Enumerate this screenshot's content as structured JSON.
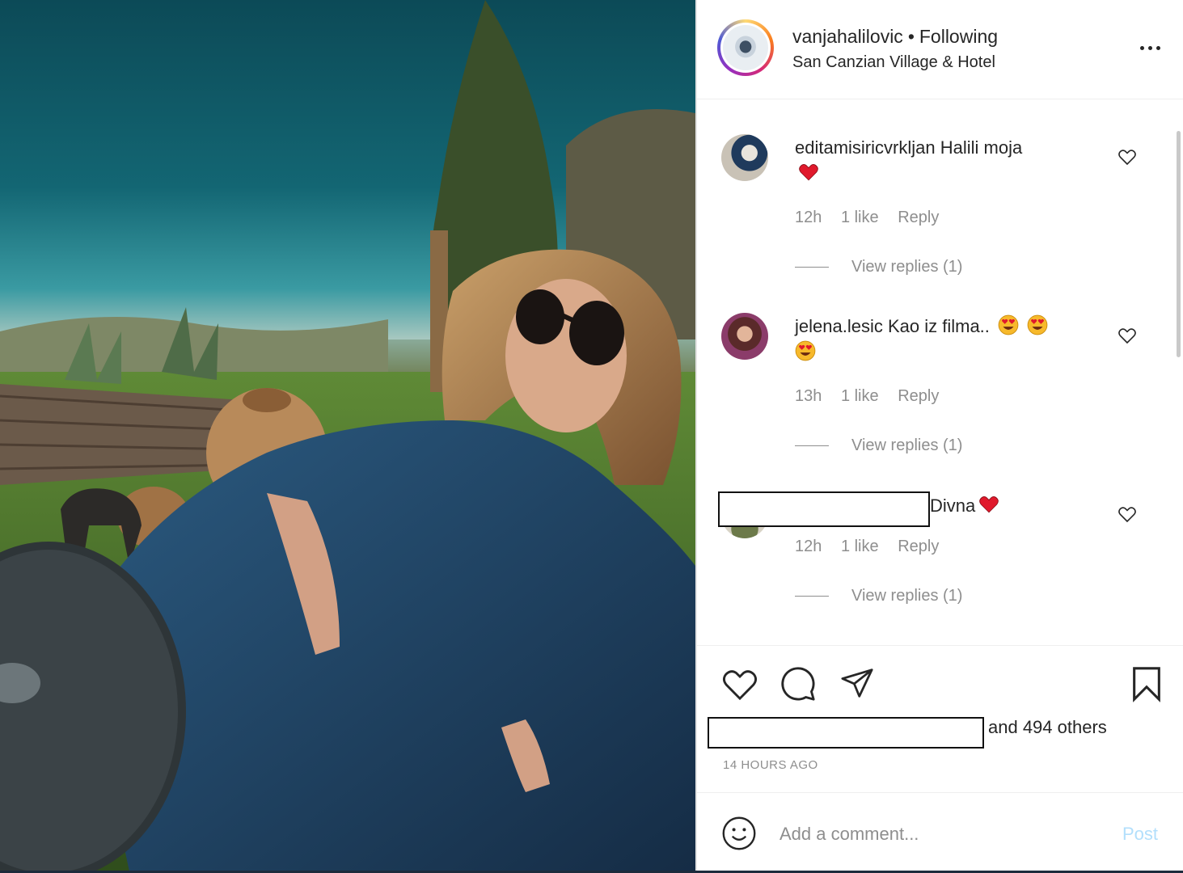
{
  "post_header": {
    "username": "vanjahalilovic",
    "separator": "•",
    "follow_status": "Following",
    "location": "San Canzian Village & Hotel"
  },
  "comments": [
    {
      "username": "editamisiricvrkljan",
      "text": "Halili moja",
      "emoji": [
        "heart"
      ],
      "time": "12h",
      "likes": "1 like",
      "reply": "Reply",
      "view_replies": "View replies (1)"
    },
    {
      "username": "jelena.lesic",
      "text": "Kao iz filma..",
      "emoji": [
        "heart-eyes",
        "heart-eyes",
        "heart-eyes"
      ],
      "time": "13h",
      "likes": "1 like",
      "reply": "Reply",
      "view_replies": "View replies (1)"
    },
    {
      "username": "",
      "text": "Divna",
      "emoji": [
        "heart"
      ],
      "time": "12h",
      "likes": "1 like",
      "reply": "Reply",
      "view_replies": "View replies (1)"
    }
  ],
  "actions": {
    "icons": [
      "heart-icon",
      "comment-icon",
      "share-icon",
      "bookmark-icon"
    ],
    "likes_text": "and 494 others",
    "timestamp": "14 HOURS AGO"
  },
  "add_comment": {
    "placeholder": "Add a comment...",
    "post_label": "Post"
  },
  "colors": {
    "text": "#262626",
    "muted": "#8e8e8e",
    "post_button_disabled": "#b2dffc",
    "emoji_heart": "#e0192c"
  }
}
